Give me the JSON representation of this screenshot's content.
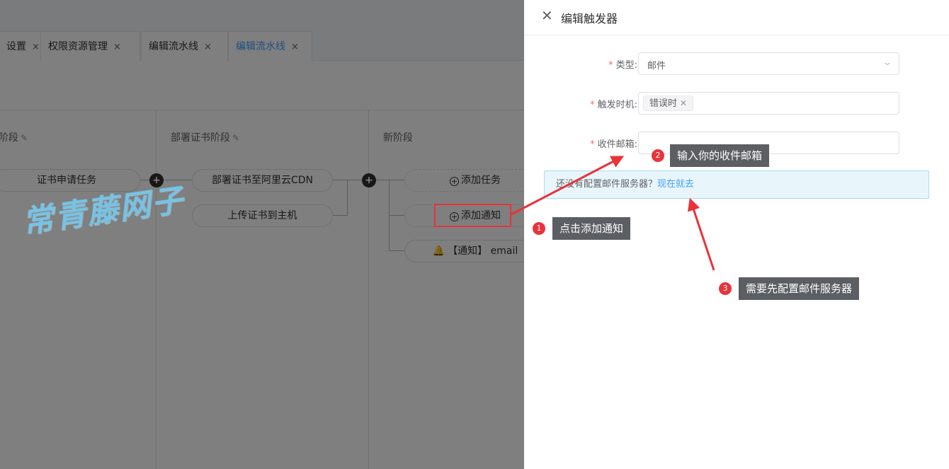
{
  "tabs": [
    {
      "label": "设置",
      "active": false
    },
    {
      "label": "权限资源管理",
      "active": false
    },
    {
      "label": "编辑流水线",
      "active": false
    },
    {
      "label": "编辑流水线",
      "active": true
    }
  ],
  "tab_close_glyph": "×",
  "pipeline": {
    "stages": [
      {
        "title": "阶段"
      },
      {
        "title": "部署证书阶段"
      },
      {
        "title": "新阶段"
      }
    ],
    "nodes": {
      "cert_request": "证书申请任务",
      "deploy_cdn": "部署证书至阿里云CDN",
      "upload_host": "上传证书到主机",
      "add_task": "添加任务",
      "add_notify": "添加通知",
      "notify_email": "【通知】 email"
    }
  },
  "watermark": "常青藤网子",
  "drawer": {
    "title": "编辑触发器",
    "form": {
      "type_label": "类型",
      "type_value": "邮件",
      "trigger_label": "触发时机",
      "trigger_tag": "错误时",
      "email_label": "收件邮箱",
      "email_value": "",
      "email_placeholder": ""
    },
    "notice": {
      "text": "还没有配置邮件服务器？",
      "link": "现在就去"
    }
  },
  "callouts": [
    {
      "num": "1",
      "text": "点击添加通知"
    },
    {
      "num": "2",
      "text": "输入你的收件邮箱"
    },
    {
      "num": "3",
      "text": "需要先配置邮件服务器"
    }
  ],
  "colors": {
    "accent": "#409eff",
    "required": "#f56c6c",
    "callout_bg": "#5b5e63",
    "callout_badge": "#e8333a",
    "notice_bg": "#e8f6fc",
    "watermark": "#6ec8f0"
  },
  "icons": {
    "close": "close-icon",
    "chevron": "chevron-down-icon",
    "edit": "edit-icon",
    "plus": "plus-circle-icon",
    "bell": "bell-icon"
  }
}
